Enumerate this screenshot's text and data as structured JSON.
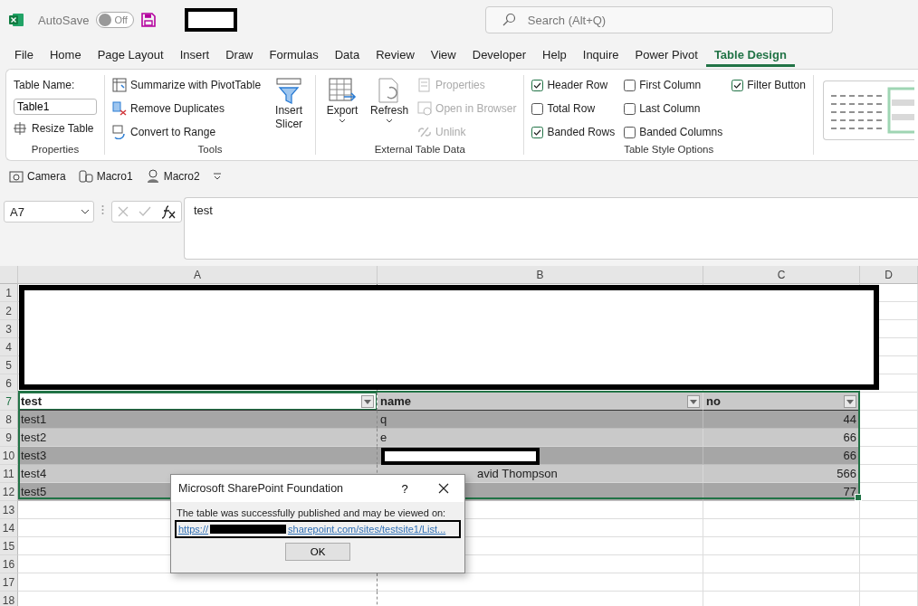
{
  "title_bar": {
    "autosave_label": "AutoSave",
    "autosave_state": "Off",
    "autosave_on": false,
    "search_placeholder": "Search (Alt+Q)"
  },
  "tabs": [
    {
      "label": "File",
      "selected": false
    },
    {
      "label": "Home",
      "selected": false
    },
    {
      "label": "Page Layout",
      "selected": false
    },
    {
      "label": "Insert",
      "selected": false
    },
    {
      "label": "Draw",
      "selected": false
    },
    {
      "label": "Formulas",
      "selected": false
    },
    {
      "label": "Data",
      "selected": false
    },
    {
      "label": "Review",
      "selected": false
    },
    {
      "label": "View",
      "selected": false
    },
    {
      "label": "Developer",
      "selected": false
    },
    {
      "label": "Help",
      "selected": false
    },
    {
      "label": "Inquire",
      "selected": false
    },
    {
      "label": "Power Pivot",
      "selected": false
    },
    {
      "label": "Table Design",
      "selected": true
    }
  ],
  "ribbon": {
    "groups": [
      {
        "label": "Properties",
        "columns": [
          [
            {
              "kind": "label",
              "text": "Table Name:"
            },
            {
              "kind": "field",
              "value": "Table1"
            },
            {
              "kind": "small",
              "text": "Resize Table",
              "disabled": false
            }
          ]
        ]
      },
      {
        "label": "Tools",
        "columns": [
          [
            {
              "kind": "small",
              "text": "Summarize with PivotTable",
              "disabled": false
            },
            {
              "kind": "small",
              "text": "Remove Duplicates",
              "disabled": false
            },
            {
              "kind": "small",
              "text": "Convert to Range",
              "disabled": false
            }
          ],
          [
            {
              "kind": "large",
              "text": "Insert Slicer",
              "caret": false
            }
          ]
        ]
      },
      {
        "label": "External Table Data",
        "columns": [
          [
            {
              "kind": "large",
              "text": "Export",
              "caret": true
            }
          ],
          [
            {
              "kind": "large",
              "text": "Refresh",
              "caret": true
            }
          ],
          [
            {
              "kind": "small",
              "text": "Properties",
              "disabled": true
            },
            {
              "kind": "small",
              "text": "Open in Browser",
              "disabled": true
            },
            {
              "kind": "small",
              "text": "Unlink",
              "disabled": true
            }
          ]
        ]
      },
      {
        "label": "Table Style Options",
        "columns": [
          [
            {
              "kind": "check",
              "text": "Header Row",
              "checked": true
            },
            {
              "kind": "check",
              "text": "Total Row",
              "checked": false
            },
            {
              "kind": "check",
              "text": "Banded Rows",
              "checked": true
            }
          ],
          [
            {
              "kind": "check",
              "text": "First Column",
              "checked": false
            },
            {
              "kind": "check",
              "text": "Last Column",
              "checked": false
            },
            {
              "kind": "check",
              "text": "Banded Columns",
              "checked": false
            }
          ],
          [
            {
              "kind": "check",
              "text": "Filter Button",
              "checked": true
            }
          ]
        ]
      }
    ]
  },
  "quick_access": [
    {
      "label": "Camera"
    },
    {
      "label": "Macro1"
    },
    {
      "label": "Macro2"
    }
  ],
  "formula_bar": {
    "name_box": "A7",
    "formula": "test"
  },
  "sheet": {
    "columns": [
      "A",
      "B",
      "C",
      "D"
    ],
    "rows": [
      {
        "number": "1",
        "cells": []
      },
      {
        "number": "2",
        "cells": []
      },
      {
        "number": "3",
        "cells": []
      },
      {
        "number": "4",
        "cells": []
      },
      {
        "number": "5",
        "cells": []
      },
      {
        "number": "6",
        "cells": []
      },
      {
        "number": "7",
        "kind": "header",
        "cells": [
          {
            "text": "test",
            "selected": true
          },
          {
            "text": "name",
            "selected": false
          },
          {
            "text": "no",
            "selected": false
          }
        ]
      },
      {
        "number": "8",
        "kind": "data",
        "shaded": true,
        "cells": [
          {
            "text": "test1",
            "selected": false
          },
          {
            "text": "q",
            "selected": false
          },
          {
            "text": "44",
            "selected": false
          }
        ]
      },
      {
        "number": "9",
        "kind": "data",
        "shaded": false,
        "cells": [
          {
            "text": "test2",
            "selected": false
          },
          {
            "text": "e",
            "selected": false
          },
          {
            "text": "66",
            "selected": false
          }
        ]
      },
      {
        "number": "10",
        "kind": "data",
        "shaded": true,
        "cells": [
          {
            "text": "test3",
            "selected": false
          },
          {
            "text": null,
            "selected": false
          },
          {
            "text": "66",
            "selected": false
          }
        ]
      },
      {
        "number": "11",
        "kind": "data",
        "shaded": false,
        "cells": [
          {
            "text": "test4",
            "selected": false
          },
          {
            "text": "avid Thompson",
            "selected": false
          },
          {
            "text": "566",
            "selected": false
          }
        ]
      },
      {
        "number": "12",
        "kind": "data",
        "shaded": true,
        "cells": [
          {
            "text": "test5",
            "selected": false
          },
          {
            "text": null,
            "selected": false
          },
          {
            "text": "77",
            "selected": false
          }
        ]
      },
      {
        "number": "13",
        "cells": []
      },
      {
        "number": "14",
        "cells": []
      },
      {
        "number": "15",
        "cells": []
      },
      {
        "number": "16",
        "cells": []
      },
      {
        "number": "17",
        "cells": []
      },
      {
        "number": "18",
        "cells": []
      }
    ]
  },
  "dialog": {
    "title": "Microsoft SharePoint Foundation",
    "help": "?",
    "message": "The table was successfully published and may be viewed on:",
    "link_start": "https://",
    "link_end": "sharepoint.com/sites/testsite1/List...",
    "ok": "OK"
  }
}
